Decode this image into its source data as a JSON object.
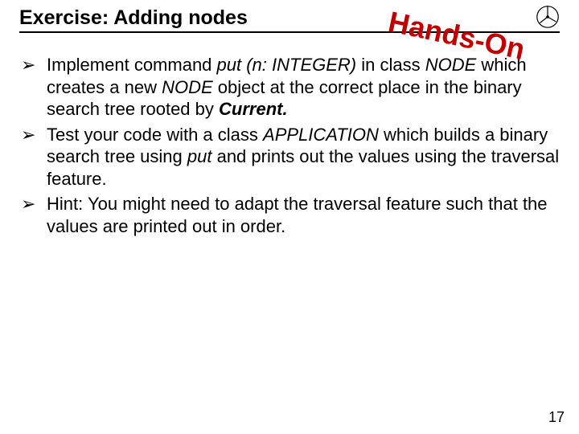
{
  "header": {
    "title": "Exercise: Adding nodes",
    "stamp": "Hands-On"
  },
  "bullets": [
    {
      "marker": "➢",
      "segments": [
        {
          "t": "Implement command ",
          "cls": ""
        },
        {
          "t": "put (n: INTEGER)",
          "cls": "i"
        },
        {
          "t": " in class ",
          "cls": ""
        },
        {
          "t": "NODE",
          "cls": "i"
        },
        {
          "t": " which creates a new ",
          "cls": ""
        },
        {
          "t": "NODE",
          "cls": "i"
        },
        {
          "t": " object at the correct place in the binary search tree rooted by ",
          "cls": ""
        },
        {
          "t": "Current.",
          "cls": "bi"
        }
      ]
    },
    {
      "marker": "➢",
      "segments": [
        {
          "t": "Test your code with a class ",
          "cls": ""
        },
        {
          "t": "APPLICATION",
          "cls": "i"
        },
        {
          "t": " which builds a binary search tree using ",
          "cls": ""
        },
        {
          "t": "put",
          "cls": "i"
        },
        {
          "t": " and prints out the values using the traversal feature.",
          "cls": ""
        }
      ]
    },
    {
      "marker": "➢",
      "segments": [
        {
          "t": "Hint: You might need to adapt the traversal feature such that the values are printed out in order.",
          "cls": ""
        }
      ]
    }
  ],
  "footer": {
    "page_number": "17"
  }
}
